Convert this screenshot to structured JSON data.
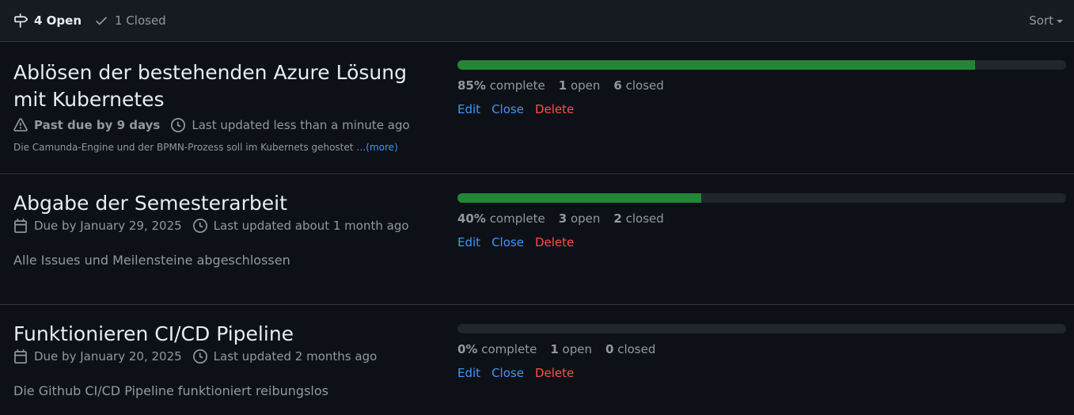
{
  "tabs": {
    "open_label": "4 Open",
    "closed_label": "1 Closed"
  },
  "sort_label": "Sort",
  "milestones": [
    {
      "title": "Ablösen der bestehenden Azure Lösung mit Kubernetes",
      "due_text": "Past due by 9 days",
      "updated": "Last updated less than a minute ago",
      "description": "Die Camunda-Engine und der BPMN-Prozess soll im Kubernets gehostet …",
      "more_label": "(more)",
      "progress_percent": 85,
      "percent_label": "85%",
      "complete_label": "complete",
      "open_count": "1",
      "open_label": "open",
      "closed_count": "6",
      "closed_label": "closed",
      "edit": "Edit",
      "close": "Close",
      "delete": "Delete"
    },
    {
      "title": "Abgabe der Semesterarbeit",
      "due_text": "Due by January 29, 2025",
      "updated": "Last updated about 1 month ago",
      "description": "Alle Issues und Meilensteine abgeschlossen",
      "progress_percent": 40,
      "percent_label": "40%",
      "complete_label": "complete",
      "open_count": "3",
      "open_label": "open",
      "closed_count": "2",
      "closed_label": "closed",
      "edit": "Edit",
      "close": "Close",
      "delete": "Delete"
    },
    {
      "title": "Funktionieren CI/CD Pipeline",
      "due_text": "Due by January 20, 2025",
      "updated": "Last updated 2 months ago",
      "description": "Die Github CI/CD Pipeline funktioniert reibungslos",
      "progress_percent": 0,
      "percent_label": "0%",
      "complete_label": "complete",
      "open_count": "1",
      "open_label": "open",
      "closed_count": "0",
      "closed_label": "closed",
      "edit": "Edit",
      "close": "Close",
      "delete": "Delete"
    }
  ],
  "colors": {
    "accent_link": "#4493f8",
    "danger": "#f85149",
    "progress": "#238636"
  }
}
